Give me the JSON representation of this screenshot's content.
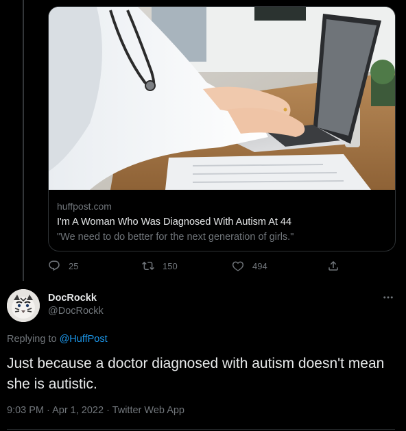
{
  "quoted_tweet": {
    "card": {
      "image_alt": "Doctor with stethoscope typing on a laptop",
      "domain": "huffpost.com",
      "title": "I'm A Woman Who Was Diagnosed With Autism At 44",
      "description": "\"We need to do better for the next generation of girls.\""
    },
    "actions": {
      "reply_count": "25",
      "retweet_count": "150",
      "like_count": "494",
      "reply_icon": "reply-icon",
      "retweet_icon": "retweet-icon",
      "like_icon": "heart-icon",
      "share_icon": "share-icon"
    }
  },
  "main_tweet": {
    "display_name": "DocRockk",
    "handle": "@DocRockk",
    "replying_prefix": "Replying to ",
    "replying_to": "@HuffPost",
    "text": "Just because a doctor diagnosed with autism doesn't mean she is autistic.",
    "timestamp": "9:03 PM · Apr 1, 2022 · Twitter Web App",
    "more_icon": "more-icon"
  },
  "colors": {
    "background": "#000000",
    "text_primary": "#e7e9ea",
    "text_secondary": "#71767b",
    "accent": "#1d9bf0",
    "border": "#2f3336"
  }
}
